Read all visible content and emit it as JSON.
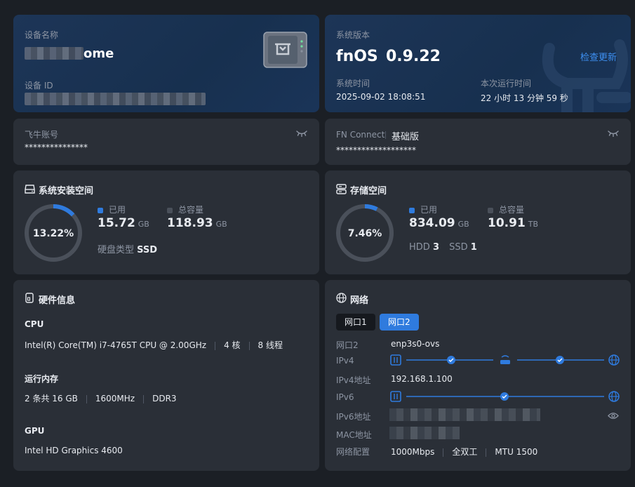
{
  "device": {
    "name_label": "设备名称",
    "name_suffix": "ome",
    "id_label": "设备 ID"
  },
  "system": {
    "version_label": "系统版本",
    "os_name": "fnOS",
    "version": "0.9.22",
    "update_link": "检查更新",
    "time_label": "系统时间",
    "time_value": "2025-09-02 18:08:51",
    "uptime_label": "本次运行时间",
    "uptime_value": "22 小时 13 分钟 59 秒"
  },
  "account": {
    "label": "飞牛账号",
    "value": "***************"
  },
  "connect": {
    "label": "FN Connect",
    "plan": "基础版",
    "value": "*******************"
  },
  "sys_storage": {
    "title": "系统安装空间",
    "percent_text": "13.22%",
    "percent": 13.22,
    "used_label": "已用",
    "used_value": "15.72",
    "used_unit": "GB",
    "total_label": "总容量",
    "total_value": "118.93",
    "total_unit": "GB",
    "disk_type_label": "硬盘类型",
    "disk_type_value": "SSD"
  },
  "storage": {
    "title": "存储空间",
    "percent_text": "7.46%",
    "percent": 7.46,
    "used_label": "已用",
    "used_value": "834.09",
    "used_unit": "GB",
    "total_label": "总容量",
    "total_value": "10.91",
    "total_unit": "TB",
    "hdd_label": "HDD",
    "hdd_count": "3",
    "ssd_label": "SSD",
    "ssd_count": "1"
  },
  "hardware": {
    "title": "硬件信息",
    "cpu_label": "CPU",
    "cpu_model": "Intel(R) Core(TM) i7-4765T CPU @ 2.00GHz",
    "cpu_cores": "4 核",
    "cpu_threads": "8 线程",
    "mem_label": "运行内存",
    "mem_size": "2 条共 16 GB",
    "mem_speed": "1600MHz",
    "mem_type": "DDR3",
    "gpu_label": "GPU",
    "gpu_model": "Intel HD Graphics 4600"
  },
  "network": {
    "title": "网络",
    "tabs": [
      "网口1",
      "网口2"
    ],
    "active_tab": 1,
    "iface_label": "网口2",
    "iface_value": "enp3s0-ovs",
    "ipv4_label": "IPv4",
    "ipv4_addr_label": "IPv4地址",
    "ipv4_addr_value": "192.168.1.100",
    "ipv6_label": "IPv6",
    "ipv6_addr_label": "IPv6地址",
    "mac_label": "MAC地址",
    "config_label": "网络配置",
    "speed": "1000Mbps",
    "duplex": "全双工",
    "mtu": "MTU 1500"
  },
  "colors": {
    "accent": "#2f7bde",
    "ring_track": "#4a505a",
    "card_bg": "#2a2f37",
    "page_bg": "#1b1f25"
  }
}
